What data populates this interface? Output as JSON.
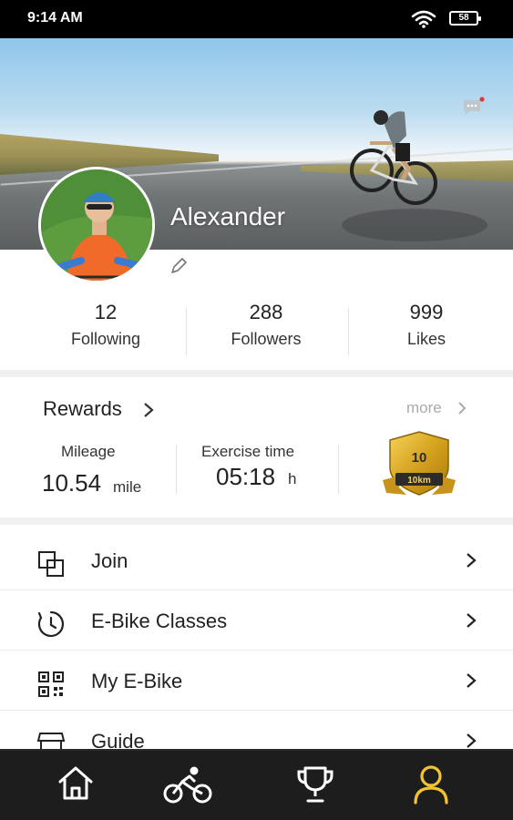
{
  "status_bar": {
    "time": "9:14 AM",
    "battery": "58"
  },
  "profile": {
    "name": "Alexander"
  },
  "stats": [
    {
      "value": "12",
      "label": "Following"
    },
    {
      "value": "288",
      "label": "Followers"
    },
    {
      "value": "999",
      "label": "Likes"
    }
  ],
  "rewards": {
    "title": "Rewards",
    "more": "more",
    "mileage": {
      "label": "Mileage",
      "value": "10.54",
      "unit": "mile"
    },
    "exercise": {
      "label": "Exercise time",
      "value": "05:18",
      "unit": "h"
    },
    "badge": {
      "value": "10",
      "unit": "10km"
    }
  },
  "menu": [
    {
      "label": "Join",
      "icon": "join-icon"
    },
    {
      "label": "E-Bike Classes",
      "icon": "timer-icon"
    },
    {
      "label": "My E-Bike",
      "icon": "qr-code-icon"
    },
    {
      "label": "Guide",
      "icon": "store-icon"
    }
  ],
  "tabs": [
    {
      "name": "home-icon",
      "active": false
    },
    {
      "name": "bike-icon",
      "active": false
    },
    {
      "name": "trophy-icon",
      "active": false
    },
    {
      "name": "profile-icon",
      "active": true
    }
  ],
  "colors": {
    "accent": "#f4c430",
    "tab_bar": "#1d1d1d",
    "notification_dot": "#e53935"
  }
}
